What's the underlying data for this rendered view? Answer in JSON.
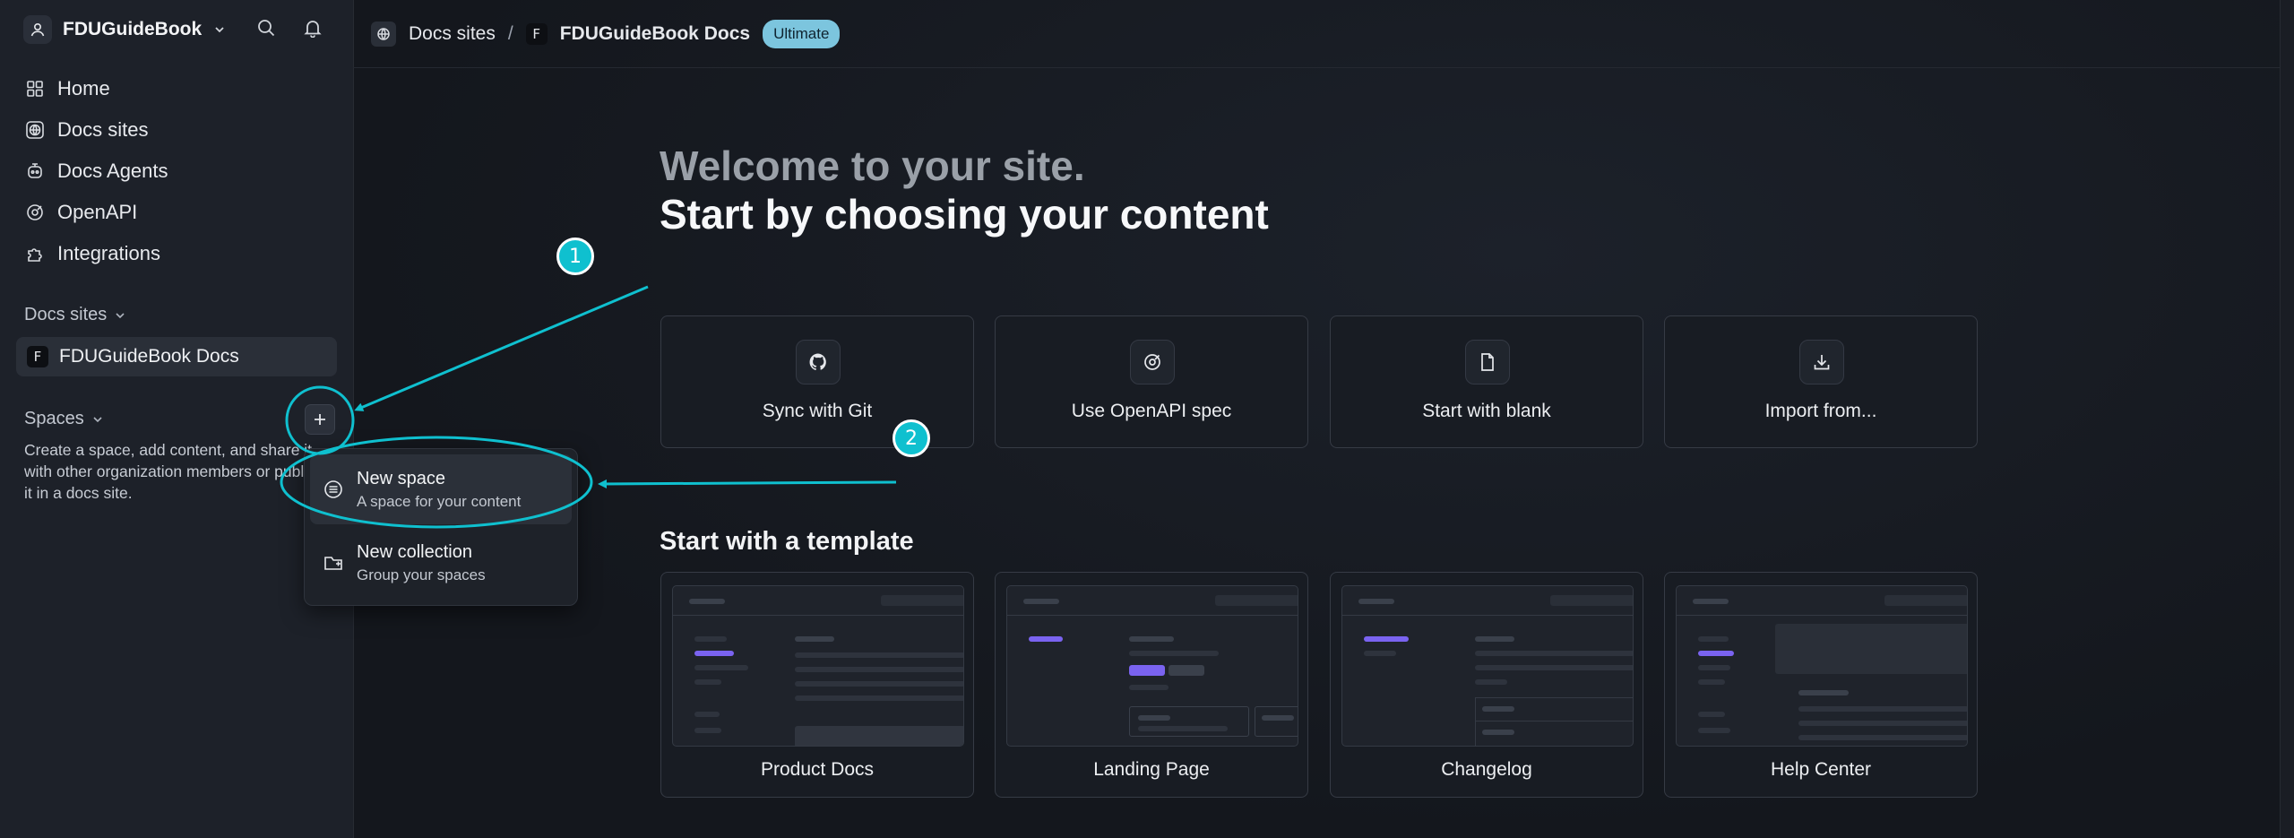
{
  "sidebar": {
    "org_name": "FDUGuideBook",
    "nav": [
      {
        "label": "Home",
        "icon": "grid-icon"
      },
      {
        "label": "Docs sites",
        "icon": "globe-icon"
      },
      {
        "label": "Docs Agents",
        "icon": "agent-icon"
      },
      {
        "label": "OpenAPI",
        "icon": "openapi-icon"
      },
      {
        "label": "Integrations",
        "icon": "puzzle-icon"
      }
    ],
    "docs_sites_label": "Docs sites",
    "site_item": {
      "badge": "F",
      "label": "FDUGuideBook Docs"
    },
    "spaces_label": "Spaces",
    "spaces_desc": "Create a space, add content, and share it with other organization members or publish it in a docs site."
  },
  "dropdown": {
    "items": [
      {
        "title": "New space",
        "subtitle": "A space for your content",
        "icon": "space-icon"
      },
      {
        "title": "New collection",
        "subtitle": "Group your spaces",
        "icon": "folder-plus-icon"
      }
    ]
  },
  "header": {
    "breadcrumb_root": "Docs sites",
    "separator": "/",
    "site_badge": "F",
    "site_name": "FDUGuideBook Docs",
    "plan_badge": "Ultimate"
  },
  "main": {
    "welcome": "Welcome to your site.",
    "headline": "Start by choosing your content",
    "content_options": [
      {
        "label": "Sync with Git",
        "icon": "github-icon"
      },
      {
        "label": "Use OpenAPI spec",
        "icon": "openapi-icon"
      },
      {
        "label": "Start with blank",
        "icon": "file-icon"
      },
      {
        "label": "Import from...",
        "icon": "download-icon"
      }
    ],
    "template_title": "Start with a template",
    "templates": [
      {
        "label": "Product Docs"
      },
      {
        "label": "Landing Page"
      },
      {
        "label": "Changelog"
      },
      {
        "label": "Help Center"
      }
    ]
  },
  "annotations": {
    "step1": "1",
    "step2": "2",
    "color": "#0fc0cf"
  },
  "colors": {
    "accent": "#7a63f0",
    "badge": "#7cc5de",
    "annotation": "#0fc0cf"
  }
}
